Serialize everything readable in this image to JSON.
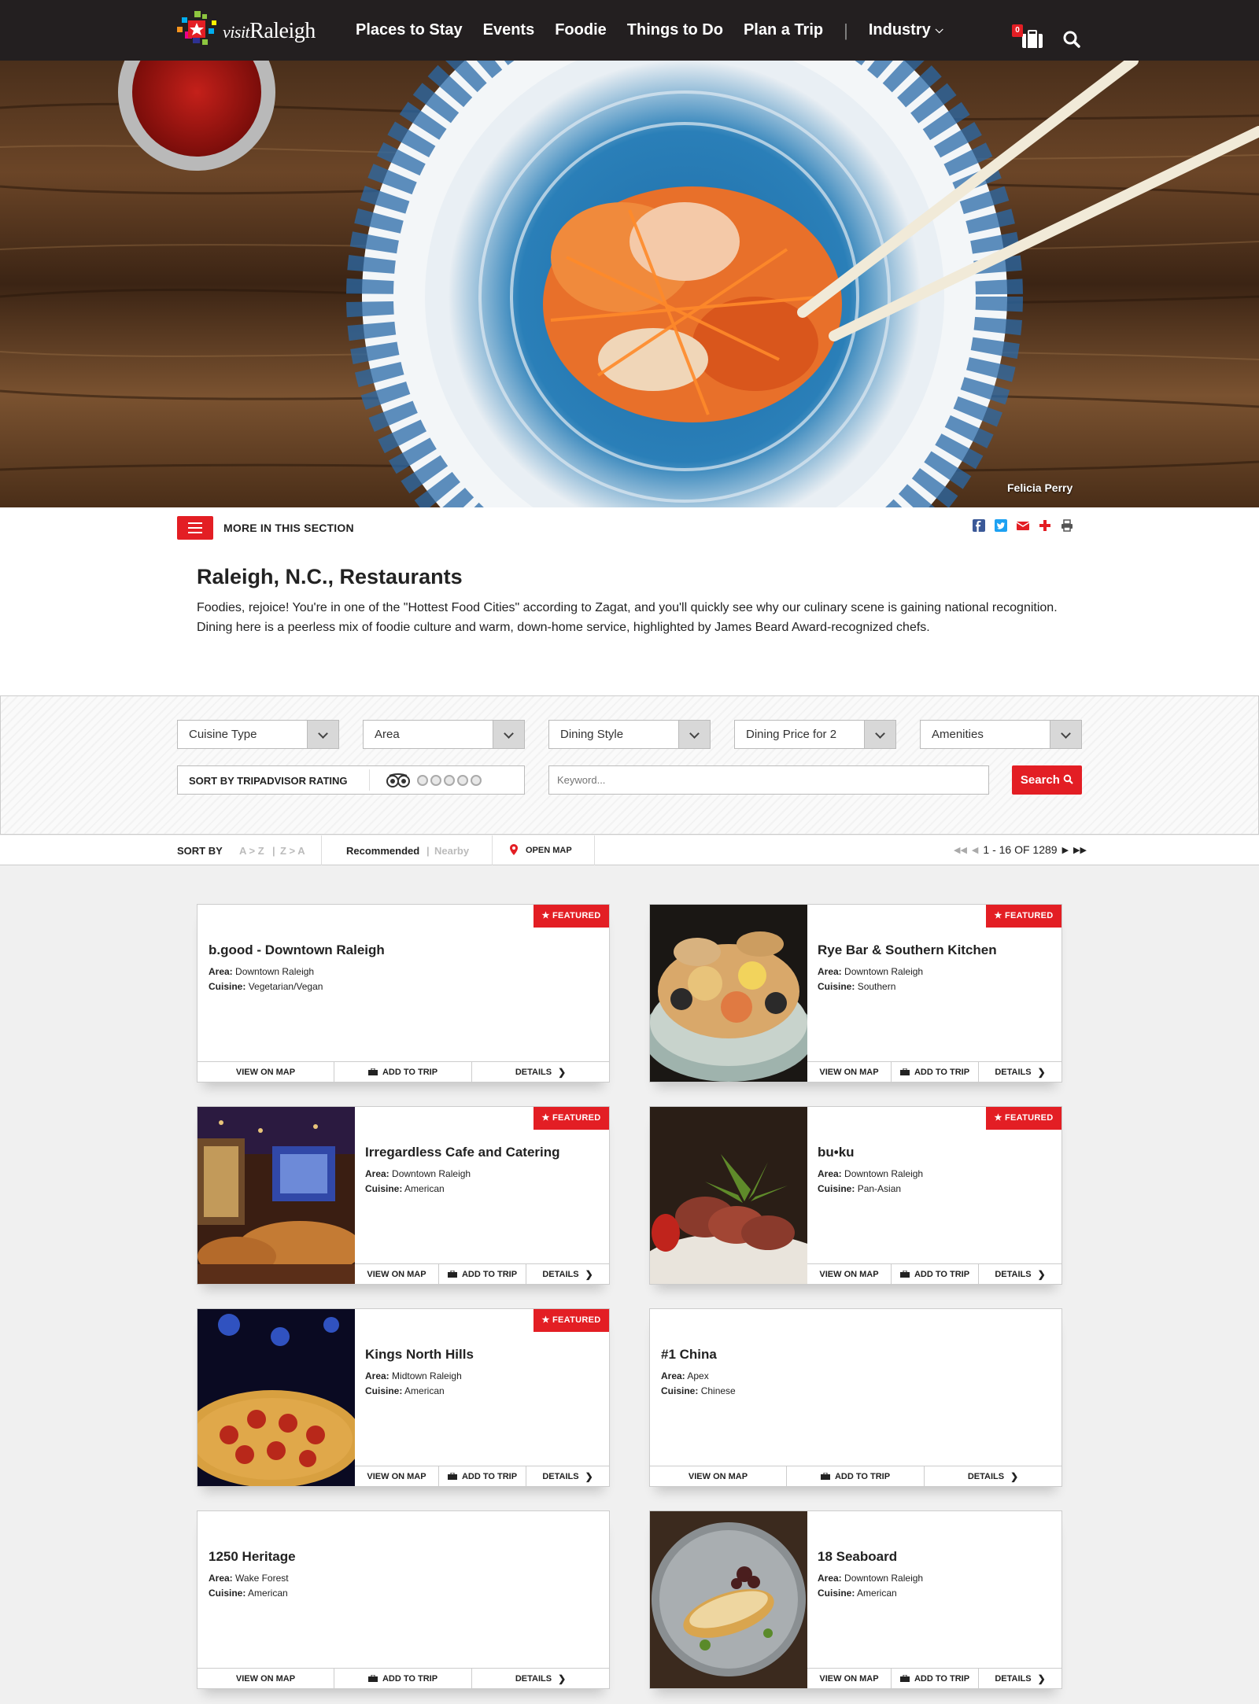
{
  "header": {
    "logo": {
      "small": "visit",
      "big": "Raleigh"
    },
    "nav": [
      "Places to Stay",
      "Events",
      "Foodie",
      "Things to Do",
      "Plan a Trip",
      "Industry"
    ],
    "trip_count": "0"
  },
  "hero": {
    "credit": "Felicia Perry"
  },
  "section": {
    "more_label": "MORE IN THIS SECTION",
    "title": "Raleigh, N.C., Restaurants",
    "intro": "Foodies, rejoice! You're in one of the \"Hottest Food Cities\" according to Zagat, and you'll quickly see why our culinary scene is gaining national recognition. Dining here is a peerless mix of foodie culture and warm, down-home service, highlighted by James Beard Award-recognized chefs."
  },
  "filters": {
    "selects": [
      "Cuisine Type",
      "Area",
      "Dining Style",
      "Dining Price for 2",
      "Amenities"
    ],
    "rating_label": "SORT BY TRIPADVISOR RATING",
    "keyword_placeholder": "Keyword...",
    "search_label": "Search"
  },
  "sortbar": {
    "label": "SORT BY",
    "az": "A > Z",
    "za": "Z > A",
    "recommended": "Recommended",
    "nearby": "Nearby",
    "open_map": "OPEN MAP",
    "pager": "1 - 16 OF 1289"
  },
  "card_actions": {
    "map": "VIEW ON MAP",
    "trip": "ADD TO TRIP",
    "details": "DETAILS"
  },
  "featured_label": "FEATURED",
  "labels": {
    "area": "Area:",
    "cuisine": "Cuisine:"
  },
  "listings": [
    {
      "name": "b.good - Downtown Raleigh",
      "area": "Downtown Raleigh",
      "cuisine": "Vegetarian/Vegan",
      "featured": true,
      "photo": "none"
    },
    {
      "name": "Rye Bar & Southern Kitchen",
      "area": "Downtown Raleigh",
      "cuisine": "Southern",
      "featured": true,
      "photo": "seafood-boil"
    },
    {
      "name": "Irregardless Cafe and Catering",
      "area": "Downtown Raleigh",
      "cuisine": "American",
      "featured": true,
      "photo": "dining-room"
    },
    {
      "name": "bu•ku",
      "area": "Downtown Raleigh",
      "cuisine": "Pan-Asian",
      "featured": true,
      "photo": "sliced-steak"
    },
    {
      "name": "Kings North Hills",
      "area": "Midtown Raleigh",
      "cuisine": "American",
      "featured": true,
      "photo": "pepperoni-pizza"
    },
    {
      "name": "#1 China",
      "area": "Apex",
      "cuisine": "Chinese",
      "featured": false,
      "photo": "none"
    },
    {
      "name": "1250 Heritage",
      "area": "Wake Forest",
      "cuisine": "American",
      "featured": false,
      "photo": "none"
    },
    {
      "name": "18 Seaboard",
      "area": "Downtown Raleigh",
      "cuisine": "American",
      "featured": false,
      "photo": "fish-plate"
    }
  ],
  "colors": {
    "brand_red": "#e31e24",
    "header_bg": "#231f20"
  }
}
